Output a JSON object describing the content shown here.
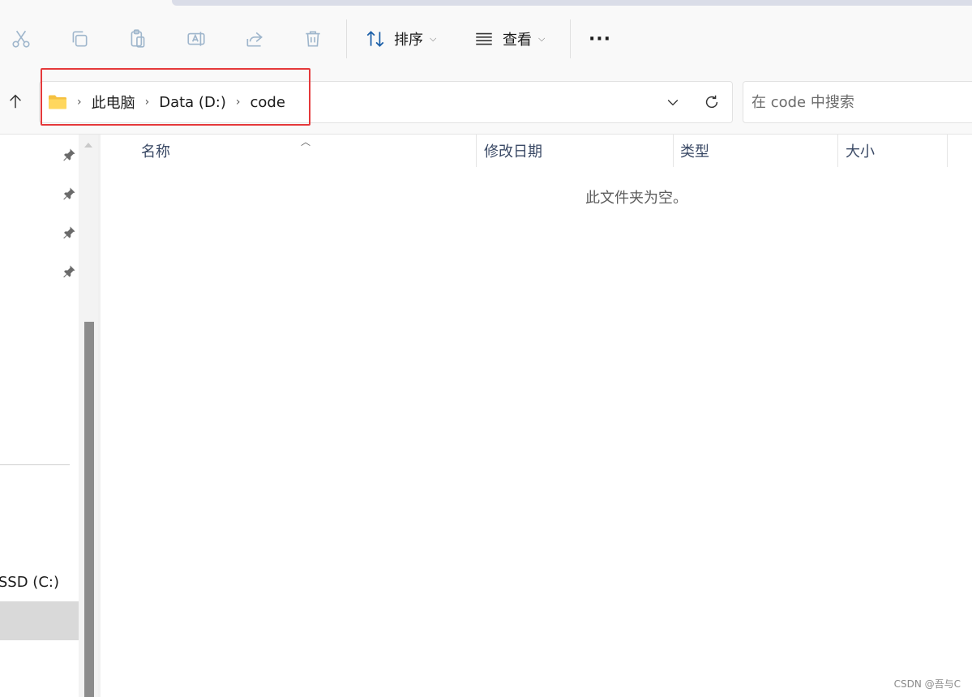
{
  "toolbar": {
    "icons": [
      "cut-icon",
      "copy-icon",
      "paste-icon",
      "rename-icon",
      "share-icon",
      "delete-icon"
    ],
    "sort_label": "排序",
    "view_label": "查看",
    "more_label": "···"
  },
  "address": {
    "breadcrumbs": [
      "此电脑",
      "Data (D:)",
      "code"
    ],
    "highlight_color": "#e5393b"
  },
  "search": {
    "placeholder": "在 code 中搜索"
  },
  "nav": {
    "drive_c_label": "s-SSD (C:)",
    "drive_d_label": ")"
  },
  "list": {
    "columns": [
      "名称",
      "修改日期",
      "类型",
      "大小"
    ],
    "empty_message": "此文件夹为空。"
  },
  "watermark": "CSDN @吾与C",
  "colors": {
    "accent": "#0067c0",
    "selected_bg": "#d9d9d9",
    "header_text": "#3b4a66"
  }
}
